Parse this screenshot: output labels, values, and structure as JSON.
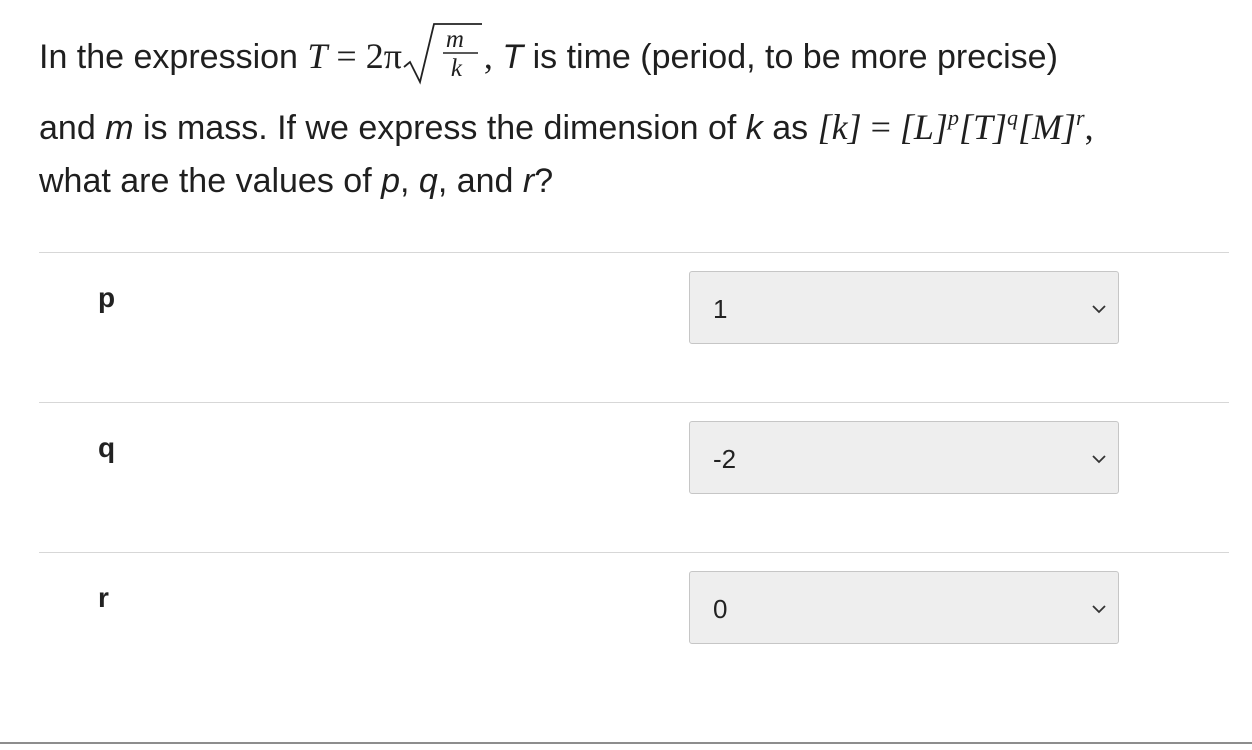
{
  "question": {
    "line1_prefix": "In the expression ",
    "formula_lhs": "T",
    "formula_eq": " = ",
    "formula_coeff": "2π",
    "fraction_numerator": "m",
    "fraction_denominator": "k",
    "line1_suffix_comma": ",",
    "line1_T": "T",
    "line1_suffix": " is time (period, to be more precise)",
    "line2_prefix": "and ",
    "line2_m": "m",
    "line2_middle": " is mass. If we express the dimension of ",
    "line2_k": "k",
    "line2_as": " as ",
    "dim_k": "[k]",
    "dim_eq": " = ",
    "dim_L": "[L]",
    "exp_p": "p",
    "dim_T": "[T]",
    "exp_q": "q",
    "dim_M": "[M]",
    "exp_r": "r",
    "line2_comma": ",",
    "line3_prefix": "what are the values of ",
    "line3_p": "p",
    "line3_sep1": ", ",
    "line3_q": "q",
    "line3_sep2": ", and ",
    "line3_r": "r",
    "line3_end": "?"
  },
  "rows": [
    {
      "label": "p",
      "selected": "1"
    },
    {
      "label": "q",
      "selected": "-2"
    },
    {
      "label": "r",
      "selected": "0"
    }
  ],
  "icons": {
    "dropdown": "chevron-down-icon"
  }
}
